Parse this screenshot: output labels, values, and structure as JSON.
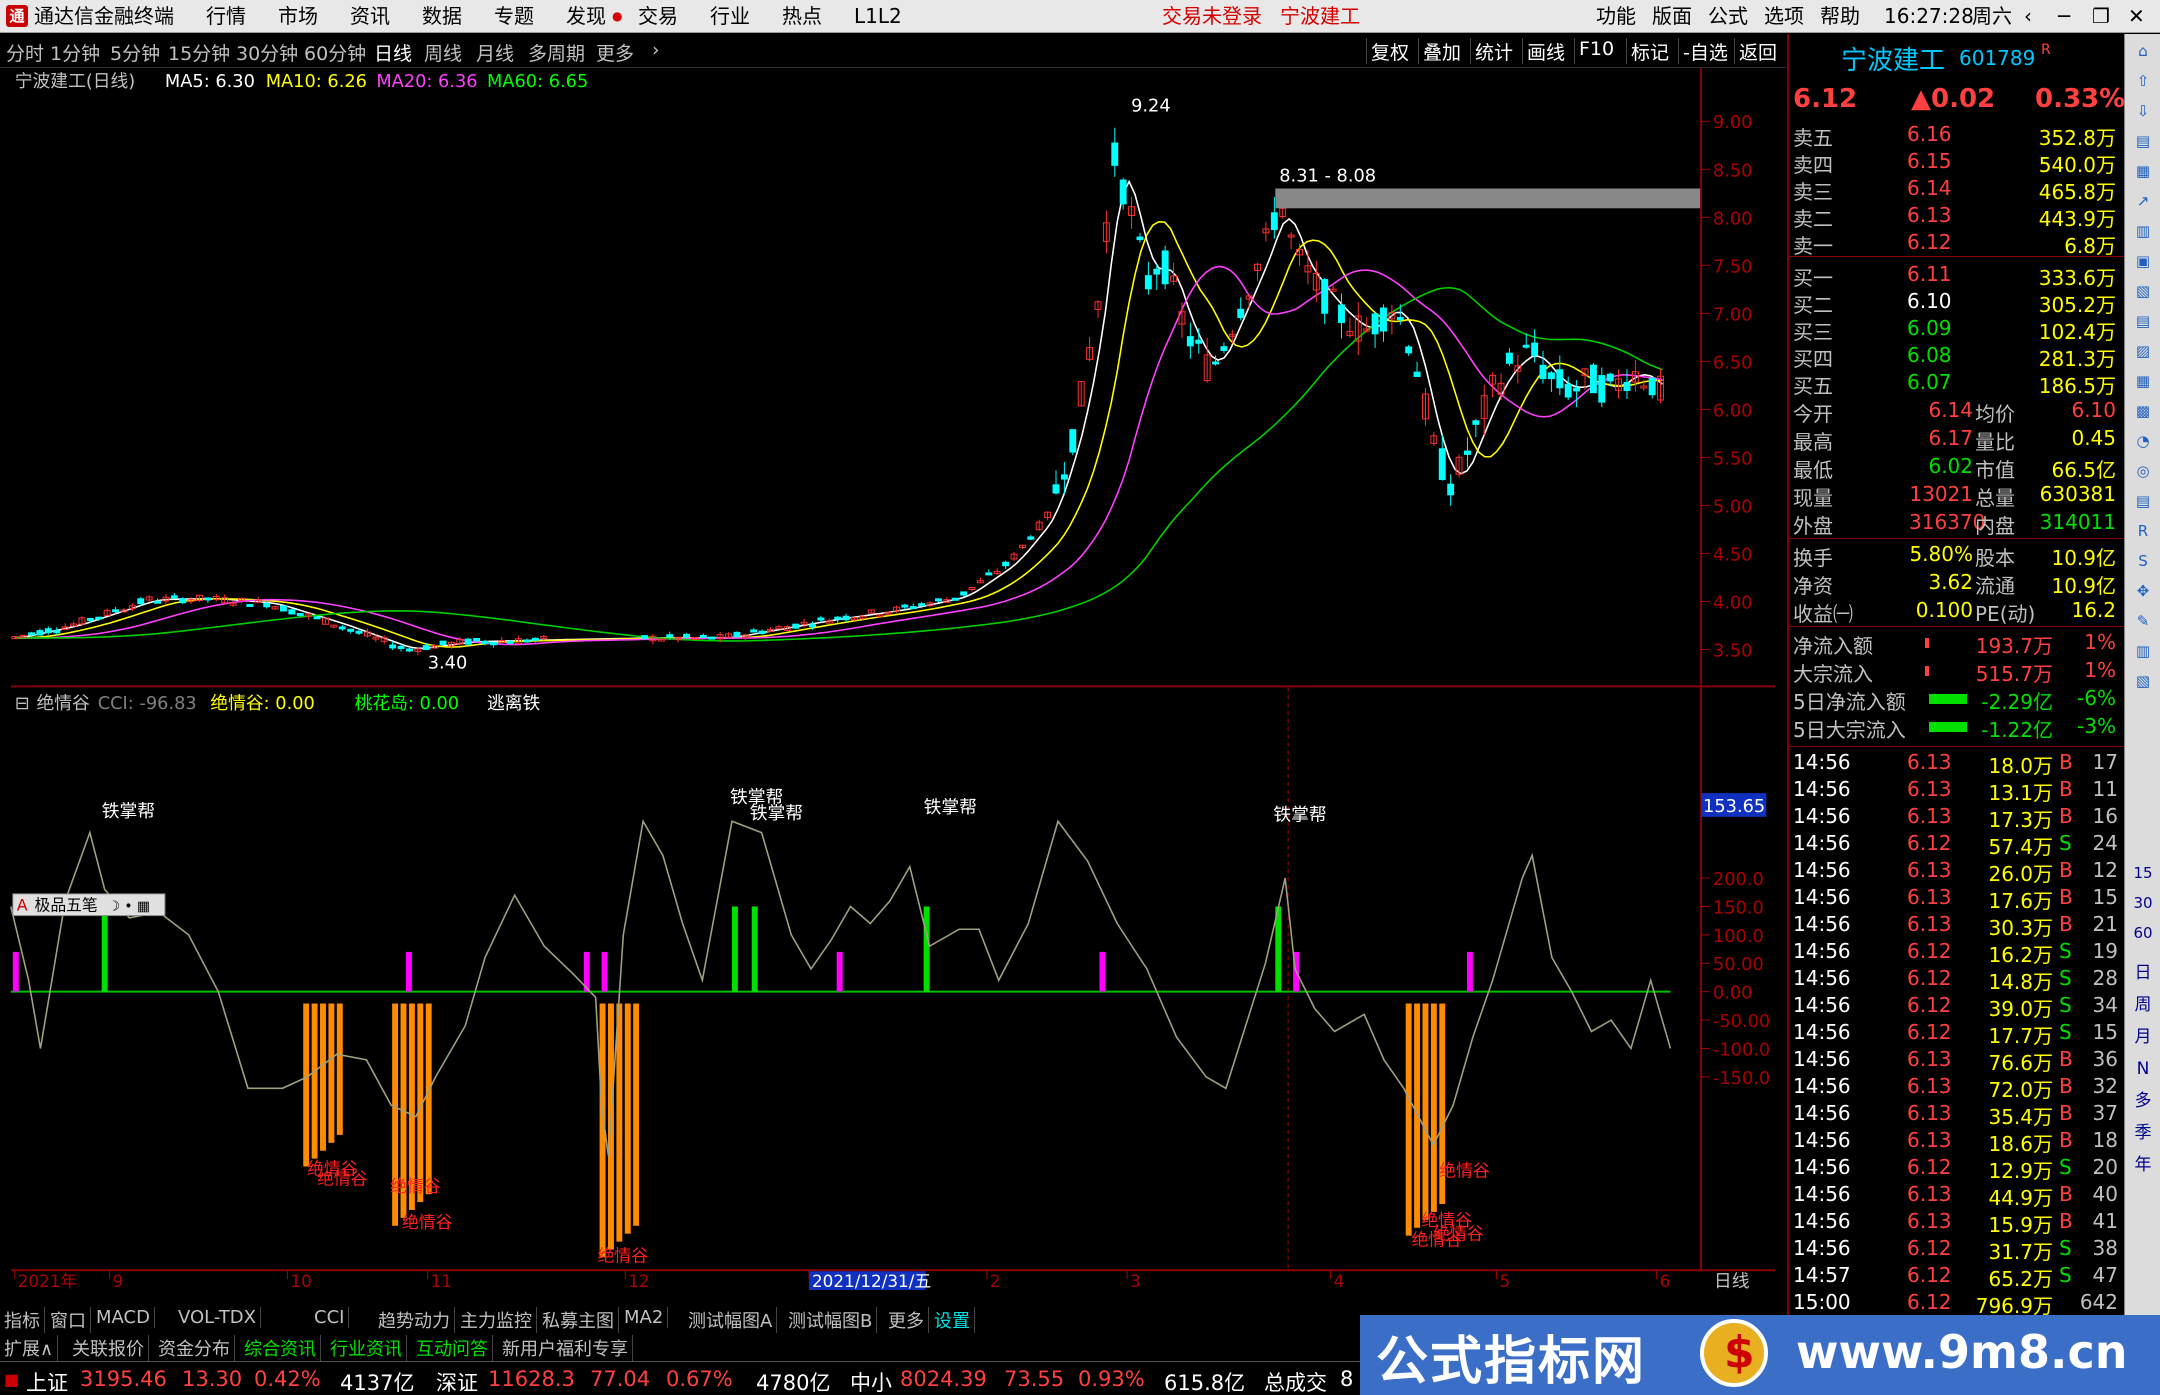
{
  "menu": {
    "app_title": "通达信金融终端",
    "items": [
      "行情",
      "市场",
      "资讯",
      "数据",
      "专题",
      "发现",
      "交易",
      "行业",
      "热点",
      "L1L2"
    ],
    "trade_status": "交易未登录",
    "stock_name": "宁波建工",
    "right_items": [
      "功能",
      "版面",
      "公式",
      "选项",
      "帮助"
    ],
    "time": "16:27:28",
    "weekday": "周六"
  },
  "periods": {
    "items": [
      "分时",
      "1分钟",
      "5分钟",
      "15分钟",
      "30分钟",
      "60分钟",
      "日线",
      "周线",
      "月线",
      "多周期",
      "更多"
    ],
    "active": "日线",
    "tools": [
      "复权",
      "叠加",
      "统计",
      "画线",
      "F10",
      "标记",
      "-自选",
      "返回"
    ]
  },
  "kline": {
    "title": "宁波建工(日线)",
    "ma5": "MA5: 6.30",
    "ma10": "MA10: 6.26",
    "ma20": "MA20: 6.36",
    "ma60": "MA60: 6.65",
    "high_label": "9.24",
    "low_label": "3.40",
    "gap_label": "8.31 - 8.08",
    "price_ticks": [
      "9.00",
      "8.50",
      "8.00",
      "7.50",
      "7.00",
      "6.50",
      "6.00",
      "5.50",
      "5.00",
      "4.50",
      "4.00",
      "3.50"
    ]
  },
  "indicator": {
    "title": "绝情谷",
    "cci": "CCI: -96.83",
    "jqg": "绝情谷: 0.00",
    "thd": "桃花岛: 0.00",
    "tl": "逃离铁",
    "ticks": [
      "200.0",
      "150.0",
      "100.0",
      "50.00",
      "0.00",
      "-50.00",
      "-100.0",
      "-150.0"
    ],
    "current_value": "153.65",
    "tie_label": "铁掌帮",
    "jue_label": "绝情谷",
    "toolbar_label": "极品五笔"
  },
  "dates": {
    "items": [
      "2021年",
      "9",
      "10",
      "11",
      "12",
      "2021/12/31/五",
      "2",
      "3",
      "4",
      "5",
      "6"
    ],
    "period_label": "日线"
  },
  "chart_data": {
    "type": "candlestick",
    "series": [
      {
        "name": "MA5"
      },
      {
        "name": "MA10"
      },
      {
        "name": "MA20"
      },
      {
        "name": "MA60"
      }
    ],
    "ylim": [
      3.3,
      9.4
    ],
    "high": 9.24,
    "low": 3.4,
    "last": 6.12,
    "indicator": {
      "name": "绝情谷",
      "cci": -96.83,
      "ylim": [
        -230,
        230
      ]
    }
  },
  "quote": {
    "name": "宁波建工",
    "code": "601789",
    "r": "R",
    "price": "6.12",
    "change": "▲0.02",
    "pct": "0.33%",
    "asks": [
      {
        "label": "卖五",
        "p": "6.16",
        "v": "352.8万"
      },
      {
        "label": "卖四",
        "p": "6.15",
        "v": "540.0万"
      },
      {
        "label": "卖三",
        "p": "6.14",
        "v": "465.8万"
      },
      {
        "label": "卖二",
        "p": "6.13",
        "v": "443.9万"
      },
      {
        "label": "卖一",
        "p": "6.12",
        "v": "6.8万"
      }
    ],
    "bids": [
      {
        "label": "买一",
        "p": "6.11",
        "v": "333.6万"
      },
      {
        "label": "买二",
        "p": "6.10",
        "v": "305.2万"
      },
      {
        "label": "买三",
        "p": "6.09",
        "v": "102.4万"
      },
      {
        "label": "买四",
        "p": "6.08",
        "v": "281.3万"
      },
      {
        "label": "买五",
        "p": "6.07",
        "v": "186.5万"
      }
    ],
    "stats": [
      [
        "今开",
        "6.14",
        "均价",
        "6.10"
      ],
      [
        "最高",
        "6.17",
        "量比",
        "0.45"
      ],
      [
        "最低",
        "6.02",
        "市值",
        "66.5亿"
      ],
      [
        "现量",
        "13021",
        "总量",
        "630381"
      ],
      [
        "外盘",
        "316370",
        "内盘",
        "314011"
      ]
    ],
    "stats2": [
      [
        "换手",
        "5.80%",
        "股本",
        "10.9亿"
      ],
      [
        "净资",
        "3.62",
        "流通",
        "10.9亿"
      ],
      [
        "收益㈠",
        "0.100",
        "PE(动)",
        "16.2"
      ]
    ],
    "flows": [
      [
        "净流入额",
        "193.7万",
        "1%"
      ],
      [
        "大宗流入",
        "515.7万",
        "1%"
      ],
      [
        "5日净流入额",
        "-2.29亿",
        "-6%"
      ],
      [
        "5日大宗流入",
        "-1.22亿",
        "-3%"
      ]
    ]
  },
  "ticks": [
    [
      "14:56",
      "6.13",
      "18.0万",
      "B",
      "17"
    ],
    [
      "14:56",
      "6.13",
      "13.1万",
      "B",
      "11"
    ],
    [
      "14:56",
      "6.13",
      "17.3万",
      "B",
      "16"
    ],
    [
      "14:56",
      "6.12",
      "57.4万",
      "S",
      "24"
    ],
    [
      "14:56",
      "6.13",
      "26.0万",
      "B",
      "12"
    ],
    [
      "14:56",
      "6.13",
      "17.6万",
      "B",
      "15"
    ],
    [
      "14:56",
      "6.13",
      "30.3万",
      "B",
      "21"
    ],
    [
      "14:56",
      "6.12",
      "16.2万",
      "S",
      "19"
    ],
    [
      "14:56",
      "6.12",
      "14.8万",
      "S",
      "28"
    ],
    [
      "14:56",
      "6.12",
      "39.0万",
      "S",
      "34"
    ],
    [
      "14:56",
      "6.12",
      "17.7万",
      "S",
      "15"
    ],
    [
      "14:56",
      "6.13",
      "76.6万",
      "B",
      "36"
    ],
    [
      "14:56",
      "6.13",
      "72.0万",
      "B",
      "32"
    ],
    [
      "14:56",
      "6.13",
      "35.4万",
      "B",
      "37"
    ],
    [
      "14:56",
      "6.13",
      "18.6万",
      "B",
      "18"
    ],
    [
      "14:56",
      "6.12",
      "12.9万",
      "S",
      "20"
    ],
    [
      "14:56",
      "6.13",
      "44.9万",
      "B",
      "40"
    ],
    [
      "14:56",
      "6.13",
      "15.9万",
      "B",
      "41"
    ],
    [
      "14:56",
      "6.12",
      "31.7万",
      "S",
      "38"
    ],
    [
      "14:57",
      "6.12",
      "65.2万",
      "S",
      "47"
    ],
    [
      "15:00",
      "6.12",
      "796.9万",
      "",
      "642"
    ]
  ],
  "tabs1": [
    "指标",
    "窗口",
    "MACD",
    "VOL-TDX",
    "CCI",
    "趋势动力",
    "主力监控",
    "私募主图",
    "MA2",
    "测试幅图A",
    "测试幅图B",
    "更多",
    "设置"
  ],
  "tabs2": [
    "扩展∧",
    "关联报价",
    "资金分布",
    "综合资讯",
    "行业资讯",
    "互动问答",
    "新用户福利专享"
  ],
  "status": {
    "sh": "上证",
    "sh_v": "3195.46",
    "sh_c": "13.30",
    "sh_p": "0.42%",
    "sh_a": "4137亿",
    "sz": "深证",
    "sz_v": "11628.3",
    "sz_c": "77.04",
    "sz_p": "0.67%",
    "sz_a": "4780亿",
    "zx": "中小",
    "zx_v": "8024.39",
    "zx_c": "73.55",
    "zx_p": "0.93%",
    "zx_a": "615.8亿",
    "zc": "总成交",
    "zc_v": "8"
  },
  "banner": {
    "text": "公式指标网",
    "url": "www.9m8.cn"
  },
  "right_icons": [
    "日",
    "周",
    "月",
    "N",
    "多",
    "季",
    "年"
  ]
}
